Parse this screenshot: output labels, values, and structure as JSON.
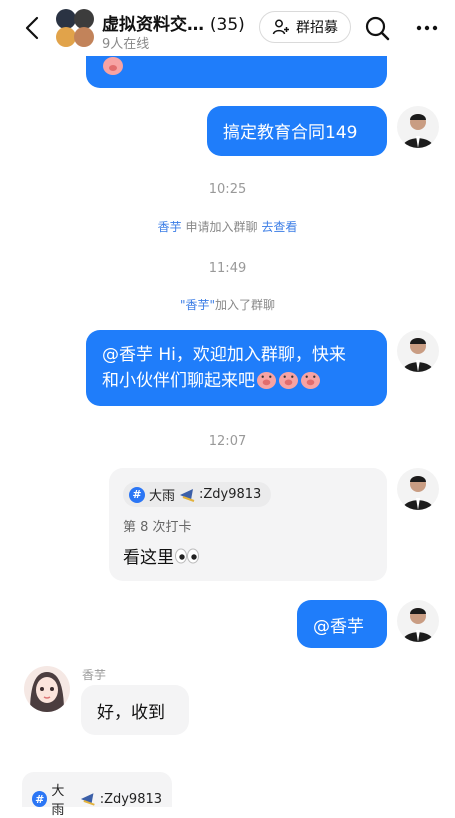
{
  "header": {
    "title": "虚拟资料交…",
    "member_count": "(35)",
    "online": "9人在线",
    "recruit_label": "群招募"
  },
  "messages": [
    {
      "type": "text",
      "text": "搞定教育合同149"
    },
    {
      "type": "time",
      "text": "10:25"
    },
    {
      "type": "system",
      "user": "香芋",
      "action": " 申请加入群聊 ",
      "link": "去查看"
    },
    {
      "type": "time",
      "text": "11:49"
    },
    {
      "type": "system",
      "user": "\"香芋\"",
      "action": "加入了群聊"
    },
    {
      "type": "text",
      "mention": "@香芋",
      "text_line1": " Hi，欢迎加入群聊，快来",
      "text_line2": "和小伙伴们聊起来吧",
      "emoji": "pig-face-icon x3"
    },
    {
      "type": "time",
      "text": "12:07"
    },
    {
      "type": "checkin",
      "tag": "大雨",
      "tag_suffix": ":Zdy9813",
      "checkin_label": "第 8 次打卡",
      "text": "看这里",
      "emoji": "eyes-icon"
    },
    {
      "type": "text",
      "text": "@香芋"
    },
    {
      "type": "text",
      "sender": "香芋",
      "text": "好，收到"
    },
    {
      "type": "tag",
      "tag": "大雨",
      "tag_suffix": ":Zdy9813"
    }
  ],
  "colors": {
    "accent": "#1f7dfa",
    "bubble_gray": "#f4f4f5"
  }
}
